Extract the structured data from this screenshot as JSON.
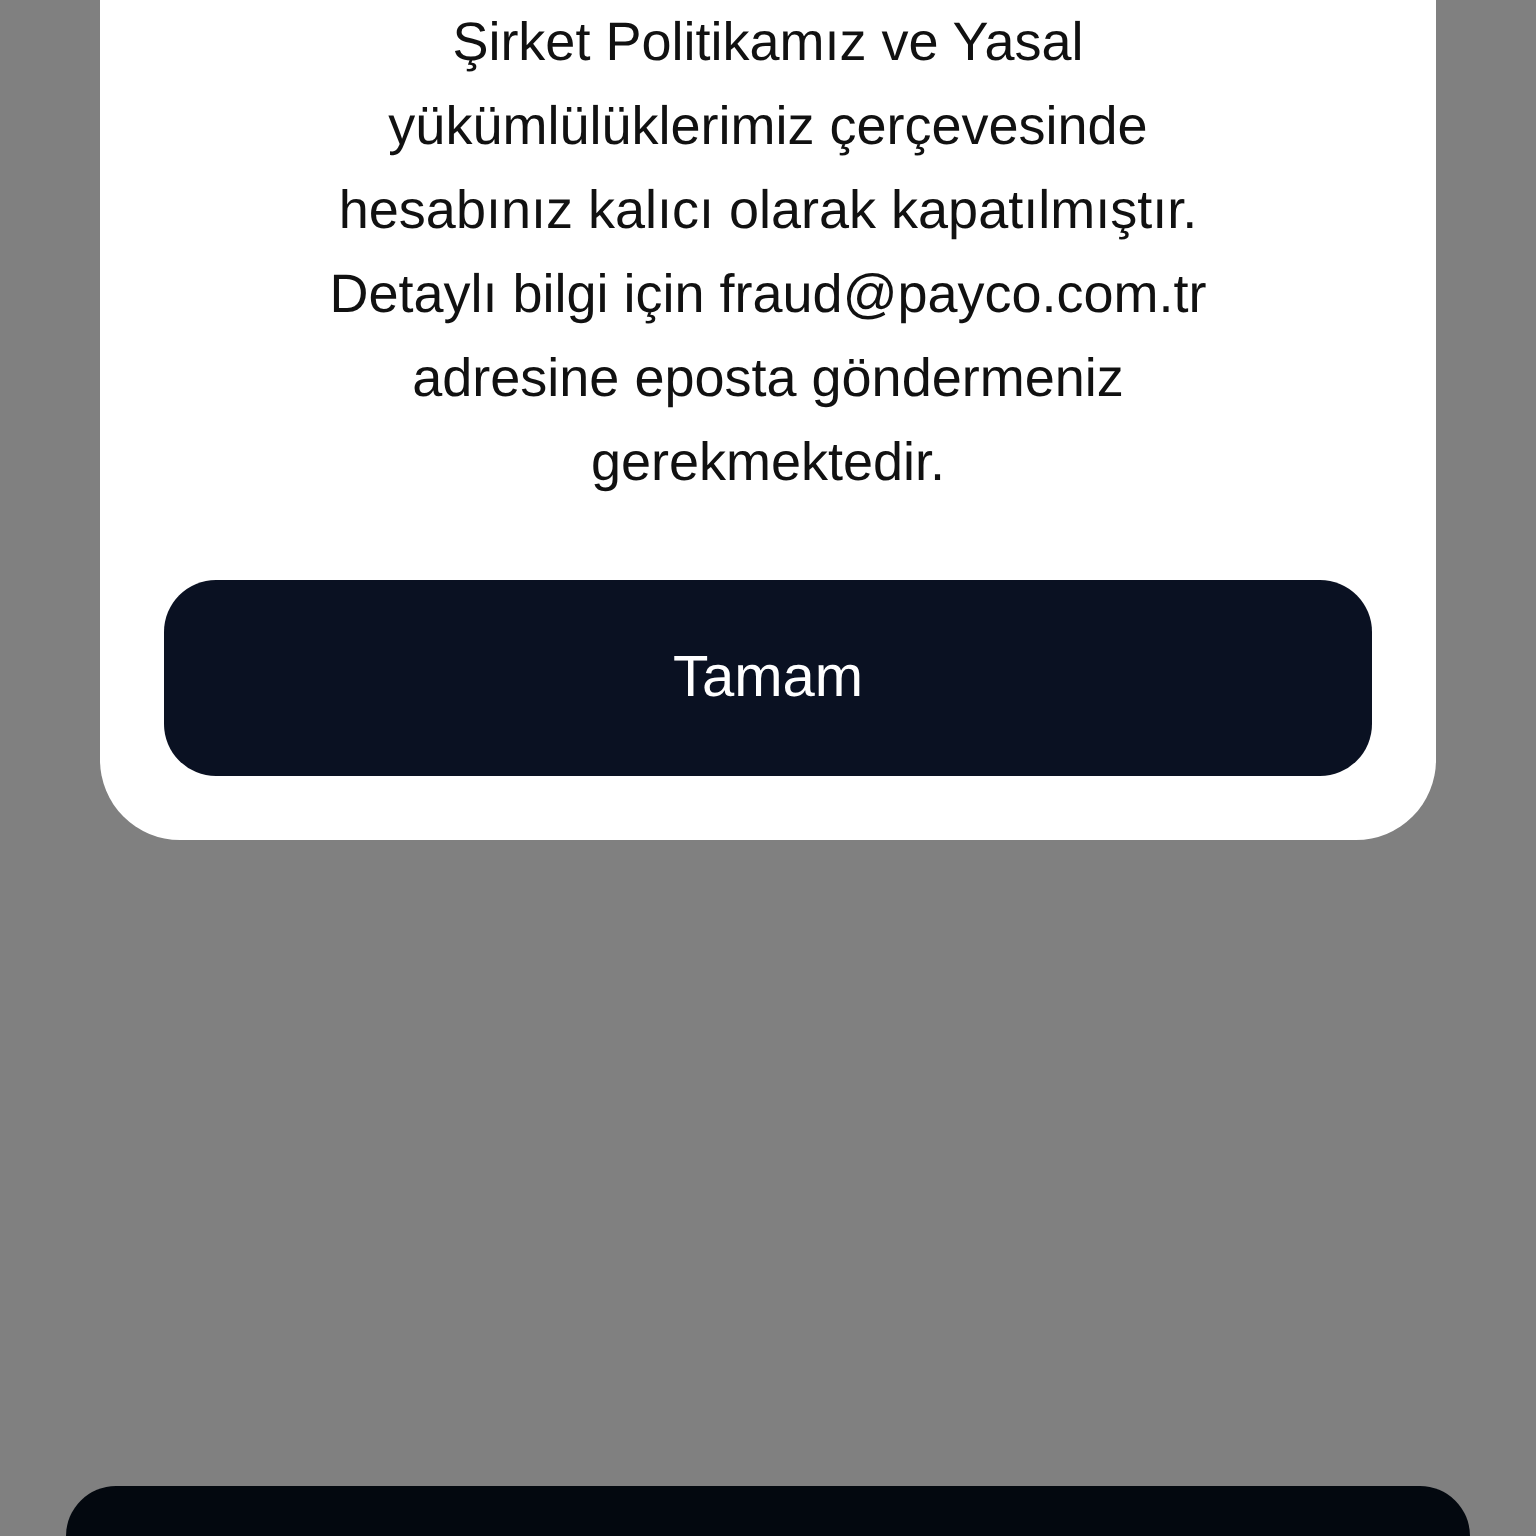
{
  "dialog": {
    "message_lines": [
      "Şirket Politikamız ve Yasal",
      "yükümlülüklerimiz çerçevesinde",
      "hesabınız kalıcı olarak kapatılmıştır.",
      "Detaylı bilgi için fraud@payco.com.tr",
      "adresine eposta göndermeniz",
      "gerekmektedir."
    ],
    "button": "Tamam"
  }
}
